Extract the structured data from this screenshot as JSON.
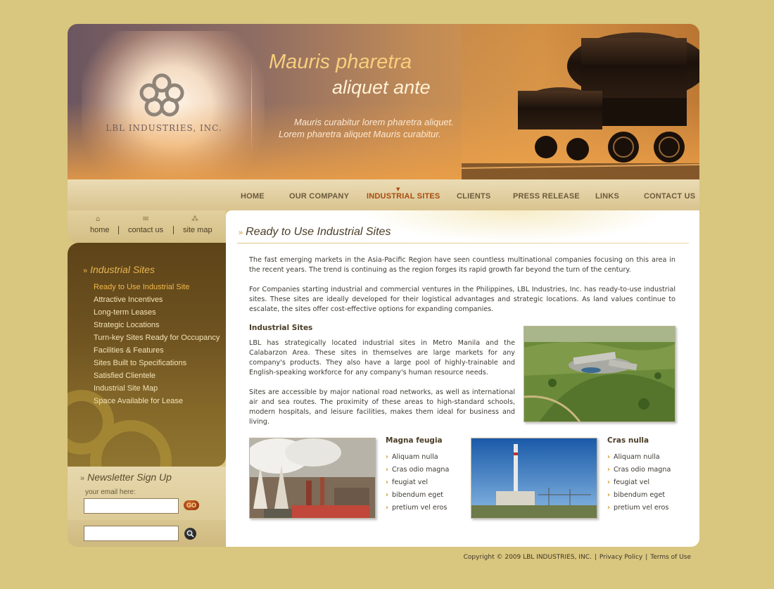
{
  "brand": {
    "company": "LBL INDUSTRIES, INC.",
    "tagline_1": "Mauris pharetra",
    "tagline_2": "aliquet ante",
    "subline_1": "Mauris curabitur lorem pharetra aliquet.",
    "subline_2": "Lorem pharetra aliquet Mauris curabitur."
  },
  "nav": {
    "items": [
      "HOME",
      "OUR COMPANY",
      "INDUSTRIAL SITES",
      "CLIENTS",
      "PRESS RELEASE",
      "LINKS",
      "CONTACT US"
    ],
    "active": "INDUSTRIAL SITES"
  },
  "utility": {
    "home": "home",
    "contact": "contact us",
    "sitemap": "site map"
  },
  "sidebar": {
    "title": "Industrial Sites",
    "items": [
      "Ready to Use Industrial Site",
      "Attractive Incentives",
      "Long-term Leases",
      "Strategic Locations",
      "Turn-key Sites Ready for Occupancy",
      "Facilities & Features",
      "Sites Built to Specifications",
      "Satisfied Clientele",
      "Industrial Site Map",
      "Space Available for Lease"
    ],
    "active_index": 0
  },
  "newsletter": {
    "title": "Newsletter Sign Up",
    "email_label": "your email here:",
    "email_value": "",
    "go_label": "GO",
    "search_value": ""
  },
  "main": {
    "title": "Ready to Use Industrial Sites",
    "para1": "The fast emerging markets in the Asia-Pacific Region have seen countless multinational companies focusing on this area in the recent years. The trend is continuing as the region forges its rapid growth far beyond the turn of the century.",
    "para2": "For Companies starting industrial and commercial ventures in the Philippines, LBL Industries, Inc. has ready-to-use industrial sites. These sites are ideally developed for their logistical advantages and strategic locations. As land values continue to escalate, the sites offer cost-effective options for expanding companies.",
    "section_title": "Industrial Sites",
    "para3": "LBL has strategically located industrial sites in Metro Manila and the Calabarzon Area. These sites in themselves are large markets for any company's products. They also have a large pool of highly-trainable and English-speaking workforce for any company's human resource needs.",
    "para4": "Sites are accessible by major national road networks, as well as international air and sea routes. The proximity of these areas to high-standard schools, modern hospitals, and leisure facilities, makes them ideal for business and living.",
    "feature1": {
      "title": "Magna feugia",
      "items": [
        "Aliquam nulla",
        "Cras odio magna",
        "feugiat vel",
        "bibendum eget",
        "pretium vel eros"
      ]
    },
    "feature2": {
      "title": "Cras nulla",
      "items": [
        "Aliquam nulla",
        "Cras odio magna",
        "feugiat vel",
        "bibendum eget",
        "pretium vel eros"
      ]
    }
  },
  "footer": {
    "copyright": "Copyright © 2009 LBL INDUSTRIES, INC.",
    "privacy": "Privacy Policy",
    "terms": "Terms of Use"
  },
  "colors": {
    "page_bg": "#d9c67f",
    "sidebar_bg": "#6e5220",
    "accent": "#e9b552",
    "active_nav": "#a94a0e"
  }
}
